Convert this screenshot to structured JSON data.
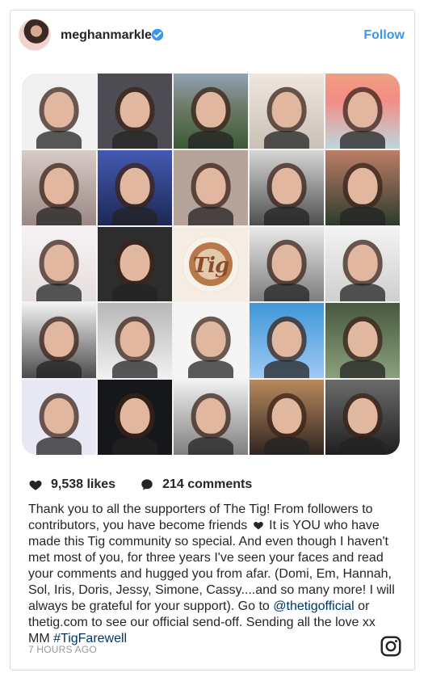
{
  "header": {
    "username": "meghanmarkle",
    "follow_label": "Follow",
    "verified_icon": "verified-badge-icon"
  },
  "media": {
    "latte_text": "Tig"
  },
  "stats": {
    "likes_text": "9,538 likes",
    "comments_text": "214 comments",
    "likes_icon": "heart-icon",
    "comments_icon": "comment-icon"
  },
  "caption": {
    "part1": "Thank you to all the supporters of The Tig! From followers to contributors, you have become friends ",
    "part2": " It is YOU who have made this Tig community so special. And even though I haven't met most of you, for three years I've seen your faces and read your comments and hugged you from afar. (Domi, Em, Hannah, Sol, Iris, Doris, Jessy, Simone, Cassy....and so many more! I will always be grateful for your support). Go to ",
    "mention": "@thetigofficial",
    "part3": " or thetig.com to see our official send-off. Sending all the love xx MM ",
    "hashtag": "#TigFarewell"
  },
  "footer": {
    "timestamp": "7 HOURS AGO",
    "instagram_icon": "instagram-icon"
  },
  "colors": {
    "link_blue": "#3897f0",
    "text": "#262626",
    "muted": "#999999",
    "hashtag": "#003569"
  }
}
